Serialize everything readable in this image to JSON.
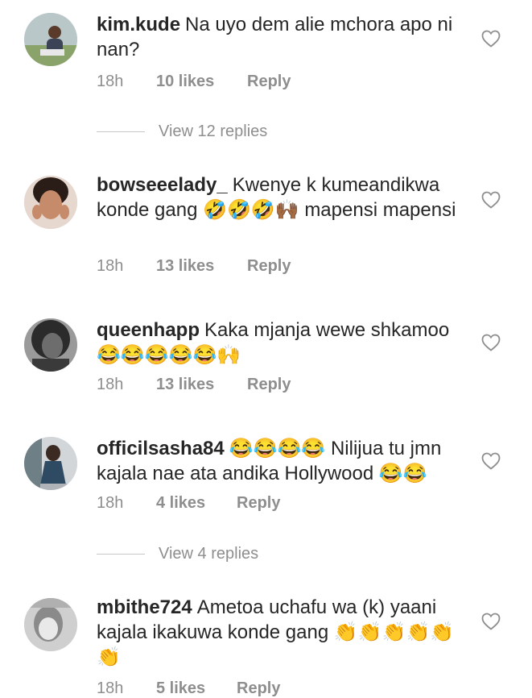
{
  "comments": [
    {
      "username": "kim.kude",
      "text": "Na uyo dem alie mchora apo ni nan?",
      "time": "18h",
      "likes": "10 likes",
      "reply": "Reply",
      "view_replies": "View 12 replies"
    },
    {
      "username": "bowseeelady_",
      "text": "Kwenye k kumeandikwa konde gang 🤣🤣🤣🙌🏾 mapensi mapensi",
      "time": "18h",
      "likes": "13 likes",
      "reply": "Reply"
    },
    {
      "username": "queenhapp",
      "text": "Kaka mjanja wewe shkamoo 😂😂😂😂😂🙌",
      "time": "18h",
      "likes": "13 likes",
      "reply": "Reply"
    },
    {
      "username": "officilsasha84",
      "text": "😂😂😂😂 Nilijua tu jmn kajala nae ata andika Hollywood 😂😂",
      "time": "18h",
      "likes": "4 likes",
      "reply": "Reply",
      "view_replies": "View 4 replies"
    },
    {
      "username": "mbithe724",
      "text": "Ametoa uchafu wa (k) yaani kajala ikakuwa konde gang 👏👏👏👏👏👏",
      "time": "18h",
      "likes": "5 likes",
      "reply": "Reply"
    }
  ],
  "icons": {
    "heart": "heart-outline-icon"
  }
}
